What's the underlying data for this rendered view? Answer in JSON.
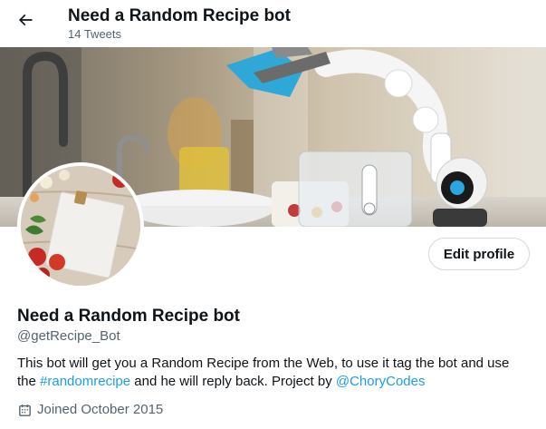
{
  "header": {
    "title": "Need a Random Recipe bot",
    "tweet_count": "14 Tweets",
    "back_icon": "arrow-left-icon"
  },
  "profile": {
    "name": "Need a Random Recipe bot",
    "handle": "@getRecipe_Bot",
    "edit_label": "Edit profile",
    "bio": {
      "part1": "This bot will get you a Random Recipe from the Web, to use it tag the bot and use the ",
      "hashtag": "#randomrecipe",
      "part2": " and he will reply back. Project by ",
      "mention": "@ChoryCodes"
    },
    "joined": "Joined October 2015",
    "joined_icon": "calendar-icon"
  },
  "colors": {
    "accent": "#1d9bf0",
    "text": "#0f1419",
    "secondary_text": "#536471",
    "border": "#cfd9de"
  }
}
